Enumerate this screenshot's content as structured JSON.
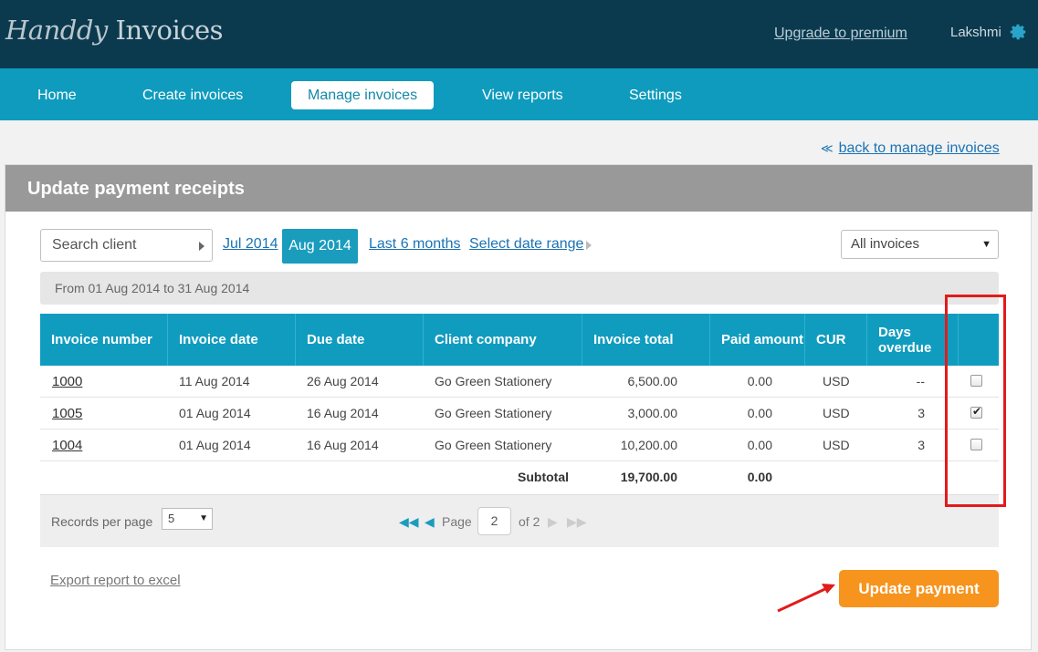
{
  "app": {
    "logo_script": "Handdy",
    "logo_rest": " Invoices"
  },
  "header": {
    "upgrade_link": "Upgrade to premium",
    "user_name": "Lakshmi",
    "settings_icon": "gear-icon"
  },
  "nav": {
    "items": [
      {
        "label": "Home"
      },
      {
        "label": "Create invoices"
      },
      {
        "label": "Manage invoices",
        "active": true
      },
      {
        "label": "View reports"
      },
      {
        "label": "Settings"
      }
    ]
  },
  "back_link": {
    "arrow": "≪",
    "label": "back to manage invoices"
  },
  "panel": {
    "title": "Update payment receipts"
  },
  "filters": {
    "search_client": "Search client",
    "dates": [
      "Jul 2014",
      "Aug 2014",
      "Last 6 months",
      "Select date range"
    ],
    "active_date": "Aug 2014",
    "invoice_filter": "All invoices",
    "range_text": "From 01 Aug 2014 to 31 Aug 2014"
  },
  "table": {
    "headers": [
      "Invoice number",
      "Invoice date",
      "Due date",
      "Client company",
      "Invoice total",
      "Paid amount",
      "CUR",
      "Days overdue",
      ""
    ],
    "rows": [
      {
        "number": "1000",
        "date": "11 Aug 2014",
        "due": "26 Aug 2014",
        "client": "Go Green Stationery",
        "total": "6,500.00",
        "paid": "0.00",
        "cur": "USD",
        "overdue": "--",
        "checked": false
      },
      {
        "number": "1005",
        "date": "01 Aug 2014",
        "due": "16 Aug 2014",
        "client": "Go Green Stationery",
        "total": "3,000.00",
        "paid": "0.00",
        "cur": "USD",
        "overdue": "3",
        "checked": true
      },
      {
        "number": "1004",
        "date": "01 Aug 2014",
        "due": "16 Aug 2014",
        "client": "Go Green Stationery",
        "total": "10,200.00",
        "paid": "0.00",
        "cur": "USD",
        "overdue": "3",
        "checked": false
      }
    ],
    "subtotal_label": "Subtotal",
    "subtotal_total": "19,700.00",
    "subtotal_paid": "0.00"
  },
  "pagination": {
    "records_label": "Records per page",
    "records_value": "5",
    "page_label": "Page",
    "page_value": "2",
    "of_label": "of 2"
  },
  "actions": {
    "export": "Export report to excel",
    "update": "Update payment"
  },
  "colors": {
    "header_bg": "#0b3a4f",
    "nav_bg": "#0f9bbd",
    "accent_orange": "#f7941d",
    "highlight_red": "#e21b1b"
  }
}
